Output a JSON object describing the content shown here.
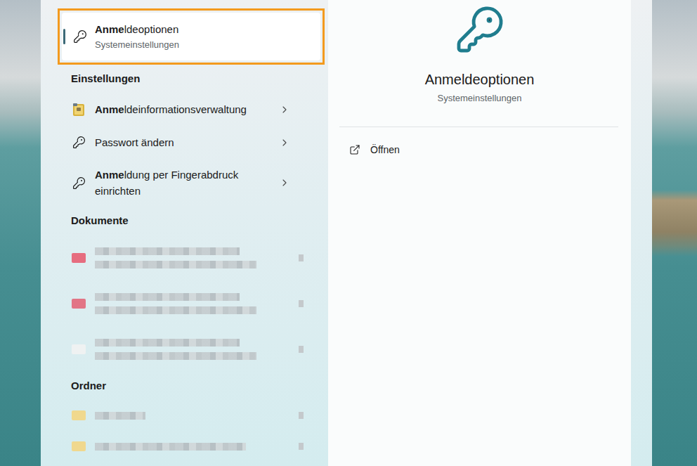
{
  "best_match": {
    "title_parts": [
      {
        "text": "Anme",
        "bold": true
      },
      {
        "text": "ldeoptionen",
        "bold": false
      }
    ],
    "subtitle": "Systemeinstellungen",
    "selected": true,
    "highlighted": true
  },
  "settings": {
    "heading": "Einstellungen",
    "items": [
      {
        "kind": "credential",
        "label_parts": [
          {
            "text": "Anme",
            "bold": true
          },
          {
            "text": "ldeinformationsverwaltung",
            "bold": false
          }
        ]
      },
      {
        "kind": "key",
        "label_parts": [
          {
            "text": "Passwort ändern",
            "bold": false
          }
        ]
      },
      {
        "kind": "key",
        "label_parts": [
          {
            "text": "Anme",
            "bold": true
          },
          {
            "text": "ldung per Fingerabdruck einrichten",
            "bold": false
          }
        ]
      }
    ]
  },
  "documents": {
    "heading": "Dokumente",
    "items": [
      {
        "color": "#e8566b"
      },
      {
        "color": "#e35f73"
      },
      {
        "color": "#f2f2f2"
      }
    ]
  },
  "folders": {
    "heading": "Ordner",
    "items": [
      {
        "color": "#f5d57c"
      },
      {
        "color": "#f5d57c"
      }
    ]
  },
  "preview": {
    "title": "Anmeldeoptionen",
    "subtitle": "Systemeinstellungen",
    "actions": [
      {
        "label": "Öffnen"
      }
    ]
  }
}
